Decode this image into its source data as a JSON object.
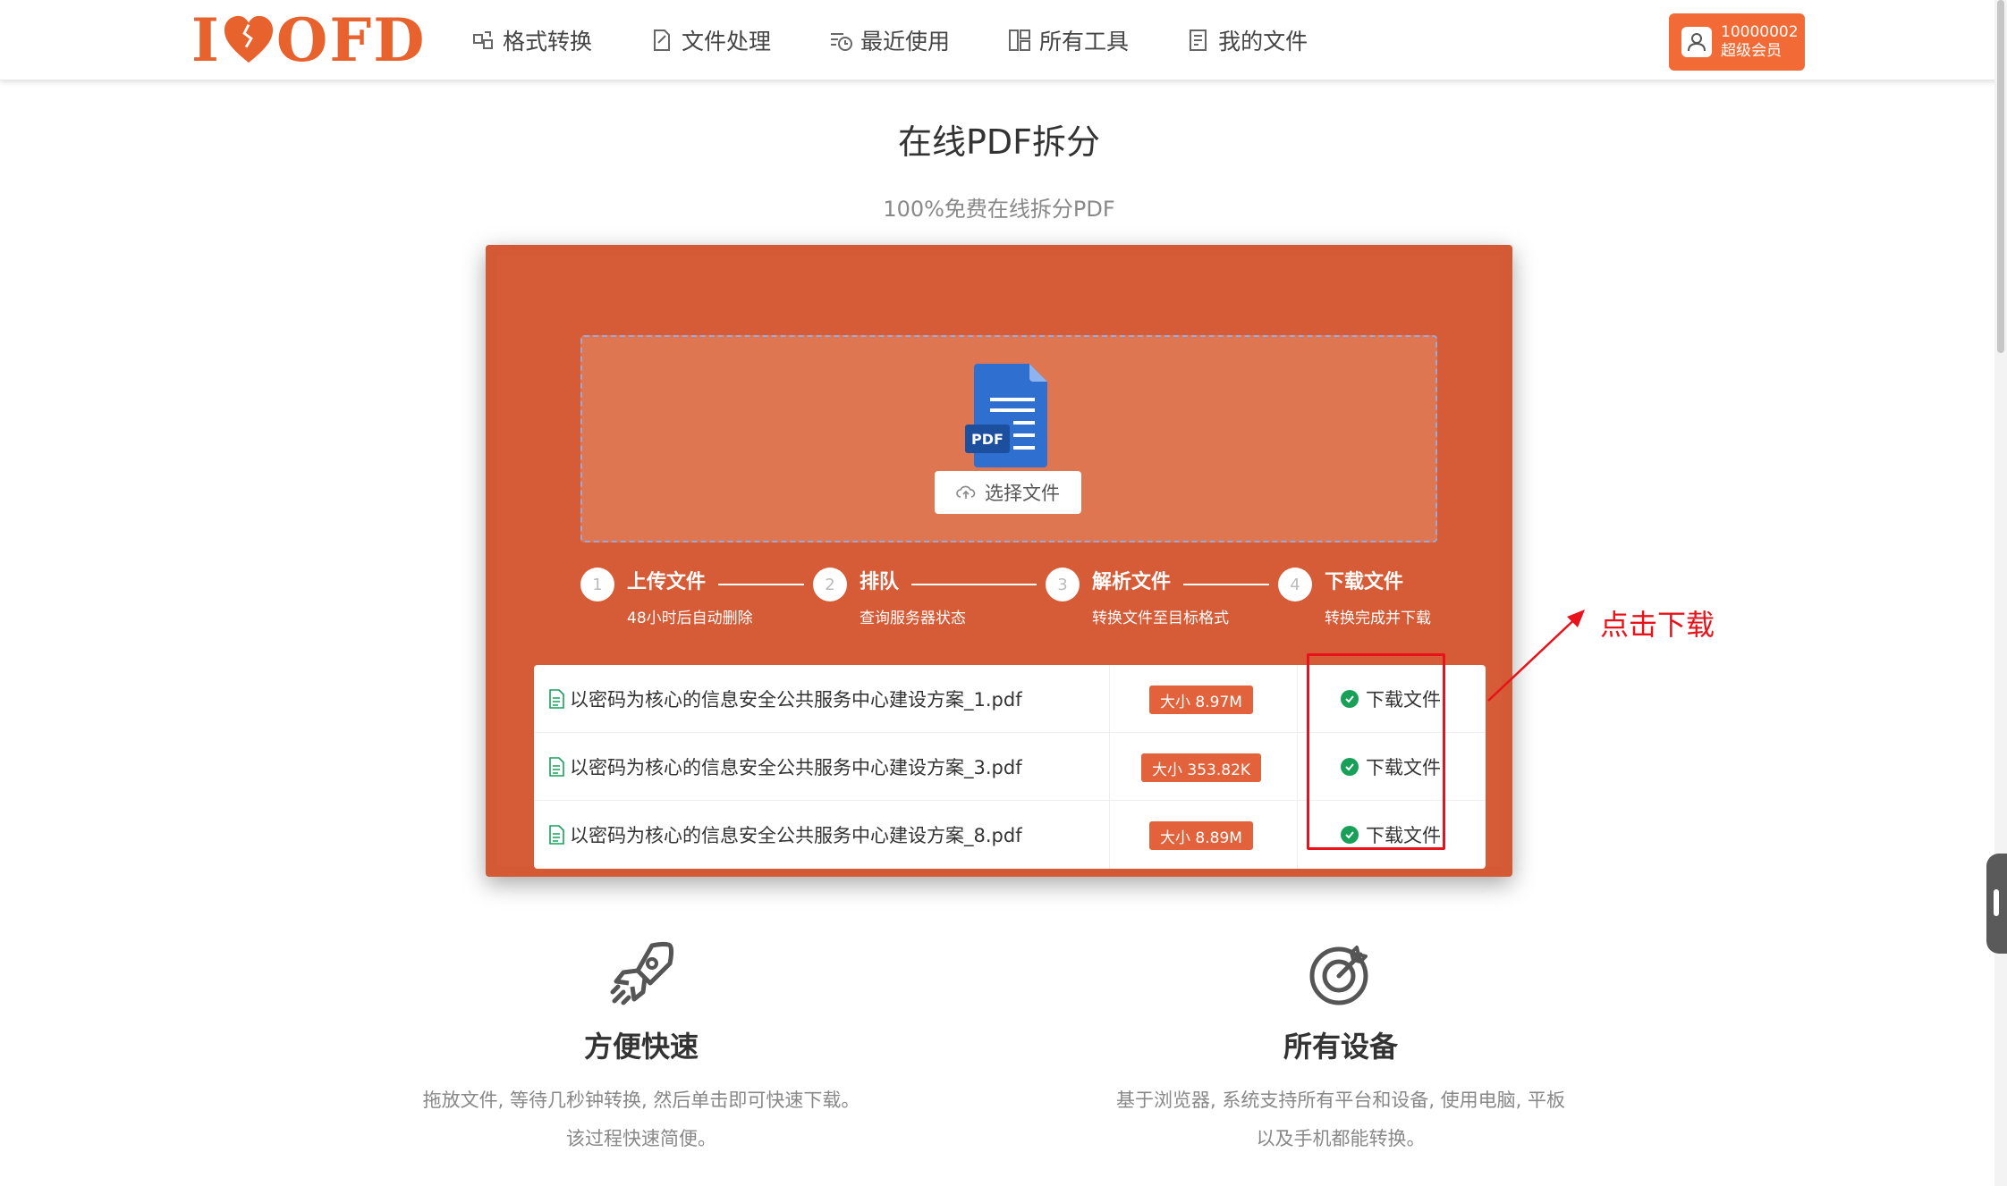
{
  "header": {
    "logo_text": "I♥OFD",
    "nav": [
      {
        "label": "格式转换",
        "icon": "convert-icon"
      },
      {
        "label": "文件处理",
        "icon": "file-edit-icon"
      },
      {
        "label": "最近使用",
        "icon": "recent-icon"
      },
      {
        "label": "所有工具",
        "icon": "tools-icon"
      },
      {
        "label": "我的文件",
        "icon": "my-files-icon"
      }
    ],
    "user": {
      "id": "10000002",
      "level": "超级会员",
      "icon": "user-avatar-icon"
    }
  },
  "page": {
    "title": "在线PDF拆分",
    "subtitle": "100%免费在线拆分PDF"
  },
  "upload": {
    "file_type_label": "PDF",
    "choose_button": "选择文件"
  },
  "steps": [
    {
      "num": "1",
      "title": "上传文件",
      "desc": "48小时后自动删除"
    },
    {
      "num": "2",
      "title": "排队",
      "desc": "查询服务器状态"
    },
    {
      "num": "3",
      "title": "解析文件",
      "desc": "转换文件至目标格式"
    },
    {
      "num": "4",
      "title": "下载文件",
      "desc": "转换完成并下载"
    }
  ],
  "files": [
    {
      "name": "以密码为核心的信息安全公共服务中心建设方案_1.pdf",
      "size": "大小 8.97M",
      "action": "下载文件"
    },
    {
      "name": "以密码为核心的信息安全公共服务中心建设方案_3.pdf",
      "size": "大小 353.82K",
      "action": "下载文件"
    },
    {
      "name": "以密码为核心的信息安全公共服务中心建设方案_8.pdf",
      "size": "大小 8.89M",
      "action": "下载文件"
    }
  ],
  "annotation": {
    "text": "点击下载",
    "color": "#e8131a"
  },
  "features": [
    {
      "title": "方便快速",
      "desc1": "拖放文件, 等待几秒钟转换, 然后单击即可快速下载。",
      "desc2": "该过程快速简便。",
      "icon": "rocket-icon"
    },
    {
      "title": "所有设备",
      "desc1": "基于浏览器, 系统支持所有平台和设备, 使用电脑, 平板",
      "desc2": "以及手机都能转换。",
      "icon": "target-icon"
    }
  ],
  "colors": {
    "brand": "#e8622e",
    "card": "#d35a35",
    "success": "#18a058"
  }
}
